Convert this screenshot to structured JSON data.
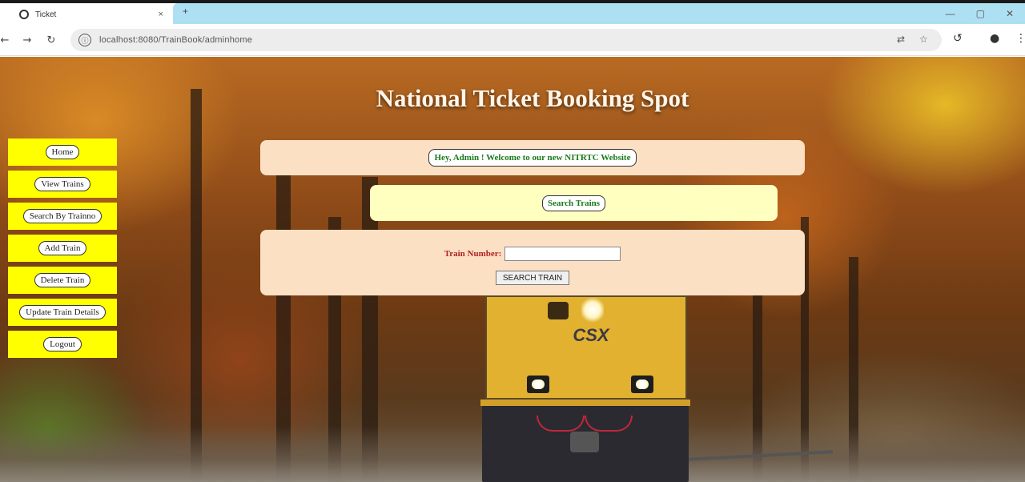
{
  "browser": {
    "tab_title": "Ticket",
    "tab_close": "×",
    "new_tab": "+",
    "url": "localhost:8080/TrainBook/adminhome",
    "win_min": "—",
    "win_max": "▢",
    "win_close": "✕",
    "back": "←",
    "forward": "→",
    "reload": "↻",
    "site_info": "ⓘ",
    "translate_icon": "⇄",
    "bookmark_icon": "☆",
    "sync_icon": "↺",
    "profile_icon": "●",
    "menu_icon": "⋮"
  },
  "page": {
    "title": "National Ticket Booking Spot"
  },
  "sidebar": {
    "items": [
      {
        "label": "Home"
      },
      {
        "label": "View Trains"
      },
      {
        "label": "Search By Trainno"
      },
      {
        "label": "Add Train"
      },
      {
        "label": "Delete Train"
      },
      {
        "label": "Update Train Details"
      },
      {
        "label": "Logout"
      }
    ]
  },
  "welcome": {
    "message": "Hey, Admin ! Welcome to our new NITRTC Website"
  },
  "search_header": {
    "label": "Search Trains"
  },
  "search_form": {
    "field_label": "Train Number:",
    "field_value": "",
    "button_label": "SEARCH TRAIN"
  },
  "train": {
    "logo": "CSX"
  }
}
